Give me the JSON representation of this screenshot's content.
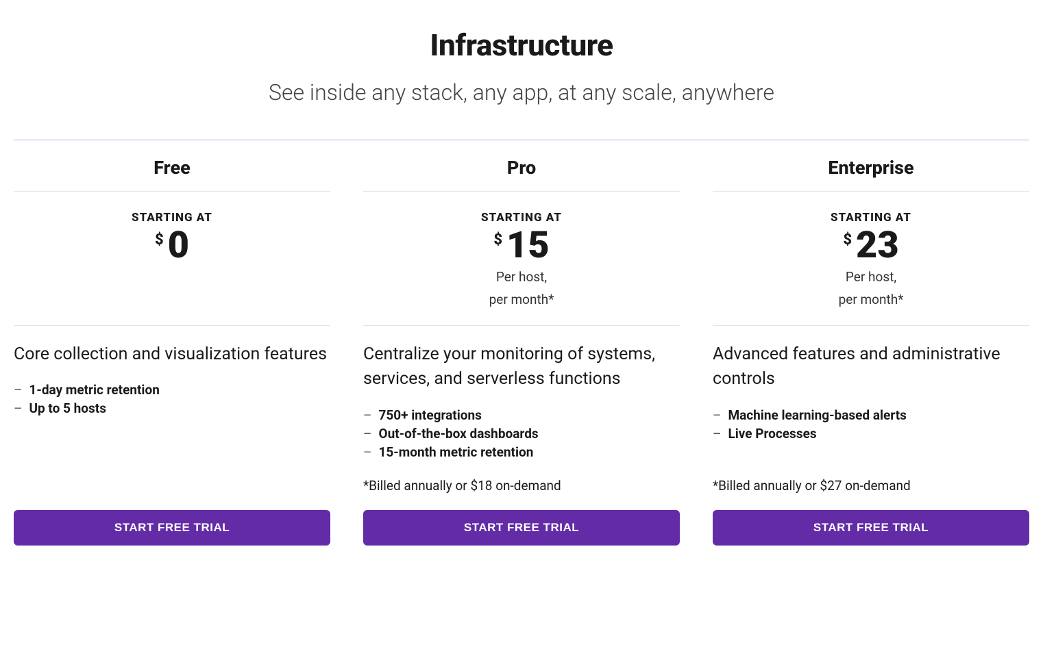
{
  "header": {
    "title": "Infrastructure",
    "subtitle": "See inside any stack, any app, at any scale, anywhere"
  },
  "plans": [
    {
      "name": "Free",
      "starting_at": "STARTING AT",
      "currency": "$",
      "amount": "0",
      "per_unit_1": "",
      "per_unit_2": "",
      "description": "Core collection and visualization features",
      "features": [
        "1-day metric retention",
        "Up to 5 hosts"
      ],
      "billing_note": "",
      "cta": "START FREE TRIAL"
    },
    {
      "name": "Pro",
      "starting_at": "STARTING AT",
      "currency": "$",
      "amount": "15",
      "per_unit_1": "Per host,",
      "per_unit_2": "per month*",
      "description": "Centralize your monitoring of systems, services, and serverless functions",
      "features": [
        "750+ integrations",
        "Out-of-the-box dashboards",
        "15-month metric retention"
      ],
      "billing_note": "*Billed annually or $18 on-demand",
      "cta": "START FREE TRIAL"
    },
    {
      "name": "Enterprise",
      "starting_at": "STARTING AT",
      "currency": "$",
      "amount": "23",
      "per_unit_1": "Per host,",
      "per_unit_2": "per month*",
      "description": "Advanced features and administrative controls",
      "features": [
        "Machine learning-based alerts",
        "Live Processes"
      ],
      "billing_note": "*Billed annually or $27 on-demand",
      "cta": "START FREE TRIAL"
    }
  ]
}
